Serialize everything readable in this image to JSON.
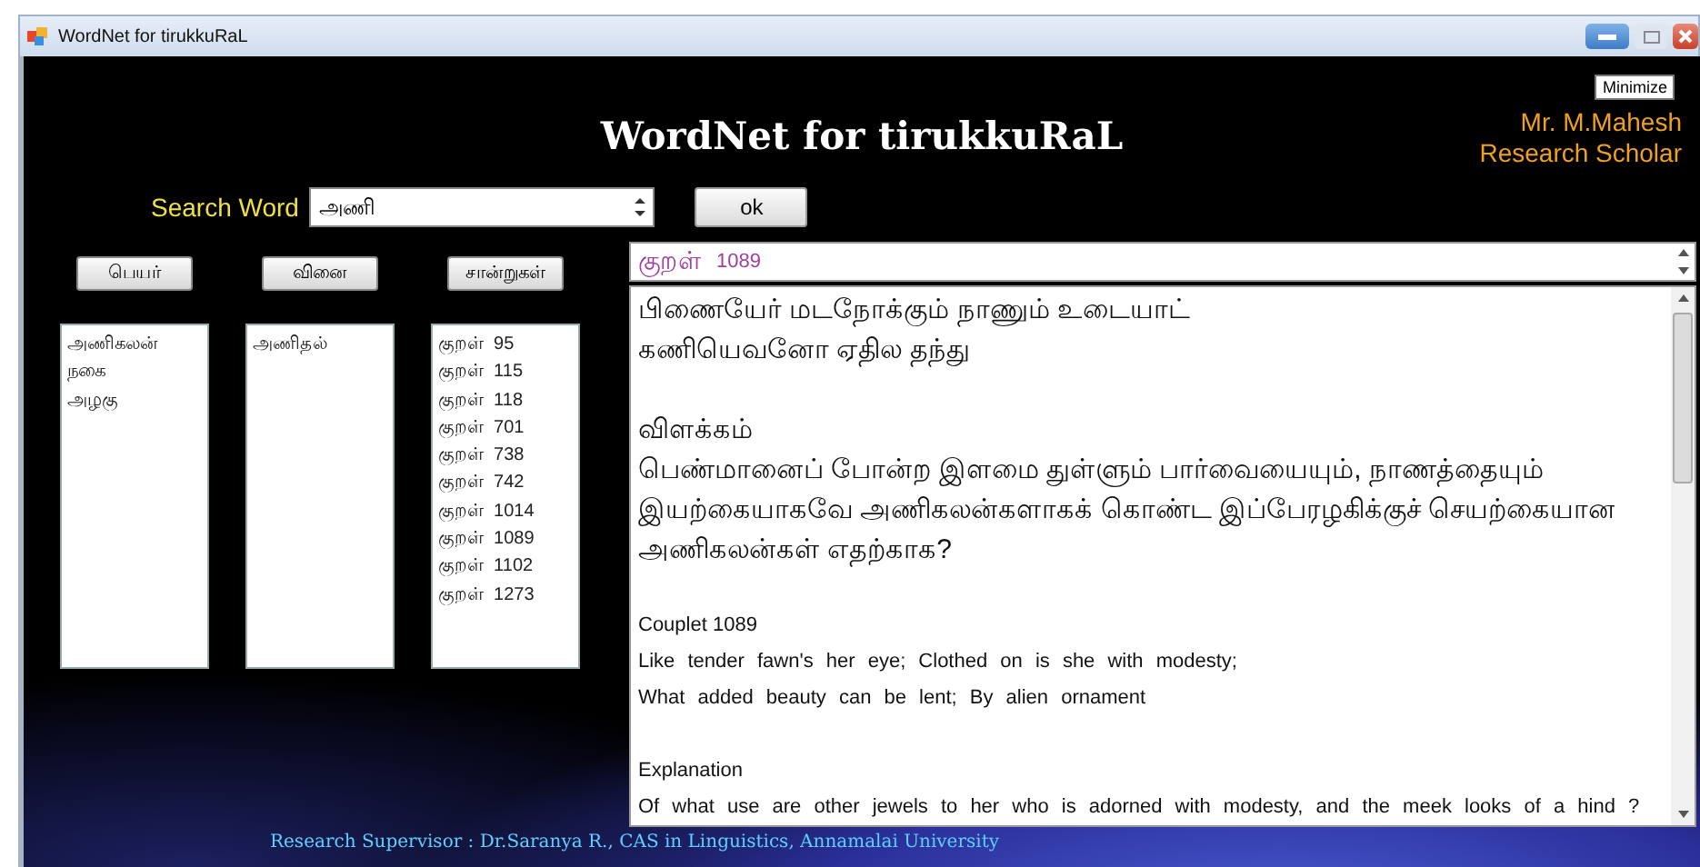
{
  "window": {
    "title": "WordNet for tirukkuRaL",
    "tooltip": "Minimize"
  },
  "header": {
    "title": "WordNet for tirukkuRaL",
    "author": [
      "Mr. M.Mahesh",
      "Research Scholar"
    ]
  },
  "search": {
    "label": "Search Word",
    "value": "அணி",
    "button": "ok"
  },
  "columns": [
    {
      "button": "பெயர்",
      "items": [
        "அணிகலன்",
        "நகை",
        "அழகு"
      ]
    },
    {
      "button": "வினை",
      "items": [
        "அணிதல்"
      ]
    },
    {
      "button": "சான்றுகள்",
      "items": [
        "குறள்  95",
        "குறள்  115",
        "குறள்  118",
        "குறள்  701",
        "குறள்  738",
        "குறள்  742",
        "குறள்  1014",
        "குறள்  1089",
        "குறள்  1102",
        "குறள்  1273"
      ]
    }
  ],
  "result": {
    "label": "குறள்",
    "number": "1089",
    "body": [
      {
        "kind": "verse",
        "text": "பிணையேர் மடநோக்கும் நாணும் உடையாட்"
      },
      {
        "kind": "verse",
        "text": "கணியெவனோ ஏதில தந்து"
      },
      {
        "kind": "heading",
        "text": "விளக்கம்"
      },
      {
        "kind": "para",
        "text": "பெண்மானைப் போன்ற இளமை துள்ளும் பார்வையையும், நாணத்தையும் இயற்கையாகவே அணிகலன்களாகக் கொண்ட இப்பேரழகிக்குச் செயற்கையான அணிகலன்கள் எதற்காக?"
      },
      {
        "kind": "en-heading",
        "text": "Couplet  1089"
      },
      {
        "kind": "en-line",
        "text": "Like tender fawn's her eye; Clothed on is she with modesty;"
      },
      {
        "kind": "en-line",
        "text": "What added beauty can be lent; By alien ornament"
      },
      {
        "kind": "en-heading",
        "text": "Explanation"
      },
      {
        "kind": "en-para",
        "text": "Of what use are other jewels to her who is adorned with modesty, and the meek looks of a hind  ?"
      }
    ]
  },
  "footer": "Research Supervisor : Dr.Saranya R., CAS in Linguistics, Annamalai University"
}
